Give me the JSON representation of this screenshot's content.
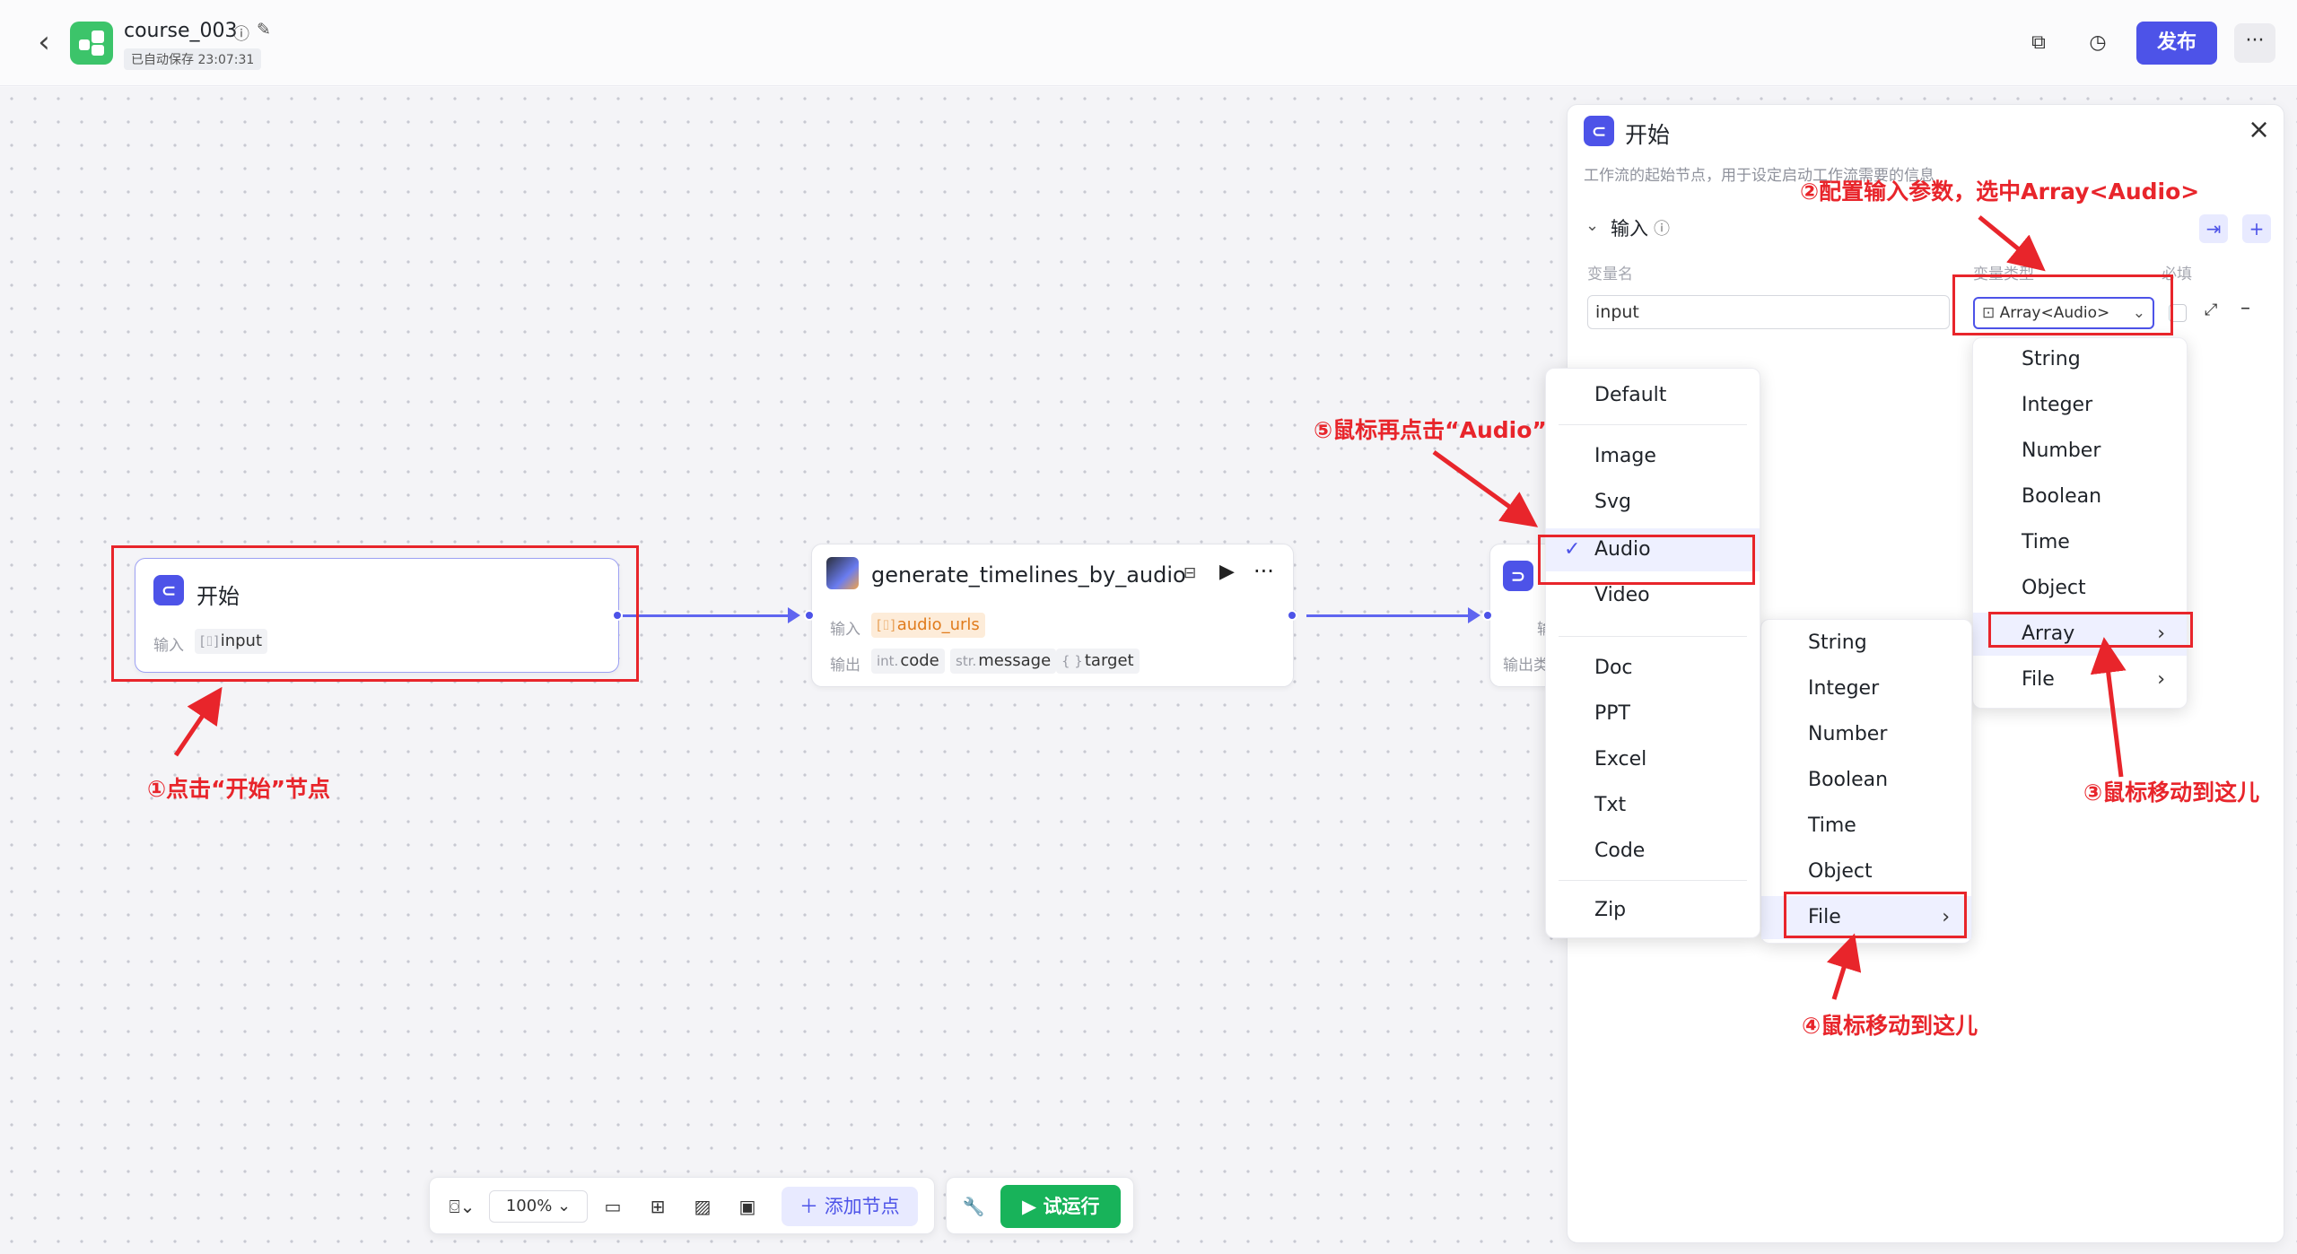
{
  "header": {
    "back_icon": "chevron-left-icon",
    "title": "course_003",
    "saved_status": "已自动保存 23:07:31",
    "publish_label": "发布",
    "more_label": "···"
  },
  "nodes": {
    "start": {
      "title": "开始",
      "input_label": "输入",
      "input_chip": "input"
    },
    "gen": {
      "title": "generate_timelines_by_audio",
      "input_label": "输入",
      "input_chip": "audio_urls",
      "output_label": "输出",
      "outputs": [
        {
          "type": "int.",
          "name": "code"
        },
        {
          "type": "str.",
          "name": "message"
        },
        {
          "type": "{ }",
          "name": "target"
        }
      ]
    },
    "end": {
      "output_label": "输出类",
      "partial_label": "输"
    }
  },
  "panel": {
    "title": "开始",
    "description": "工作流的起始节点，用于设定启动工作流需要的信息",
    "section": "输入",
    "col_name": "变量名",
    "col_type": "变量类型",
    "col_required": "必填",
    "var_name_value": "input",
    "var_type_value": "Array<Audio>"
  },
  "type_menu": {
    "items": [
      "String",
      "Integer",
      "Number",
      "Boolean",
      "Time",
      "Object",
      "Array",
      "File"
    ]
  },
  "array_menu": {
    "items": [
      "String",
      "Integer",
      "Number",
      "Boolean",
      "Time",
      "Object",
      "File"
    ]
  },
  "file_menu": {
    "group1": [
      "Default"
    ],
    "group2": [
      "Image",
      "Svg",
      "Audio",
      "Video"
    ],
    "group3": [
      "Doc",
      "PPT",
      "Excel",
      "Txt",
      "Code"
    ],
    "group4": [
      "Zip"
    ],
    "checked": "Audio"
  },
  "annotations": {
    "a1": "①点击“开始”节点",
    "a2": "②配置输入参数，选中Array<Audio>",
    "a3": "③鼠标移动到这儿",
    "a4": "④鼠标移动到这儿",
    "a5": "⑤鼠标再点击“Audio”"
  },
  "toolbar": {
    "zoom": "100%",
    "add_node": "添加节点",
    "test_run": "试运行"
  },
  "colors": {
    "accent": "#4d53e8",
    "annotation": "#e8252b",
    "run": "#18b35a"
  }
}
